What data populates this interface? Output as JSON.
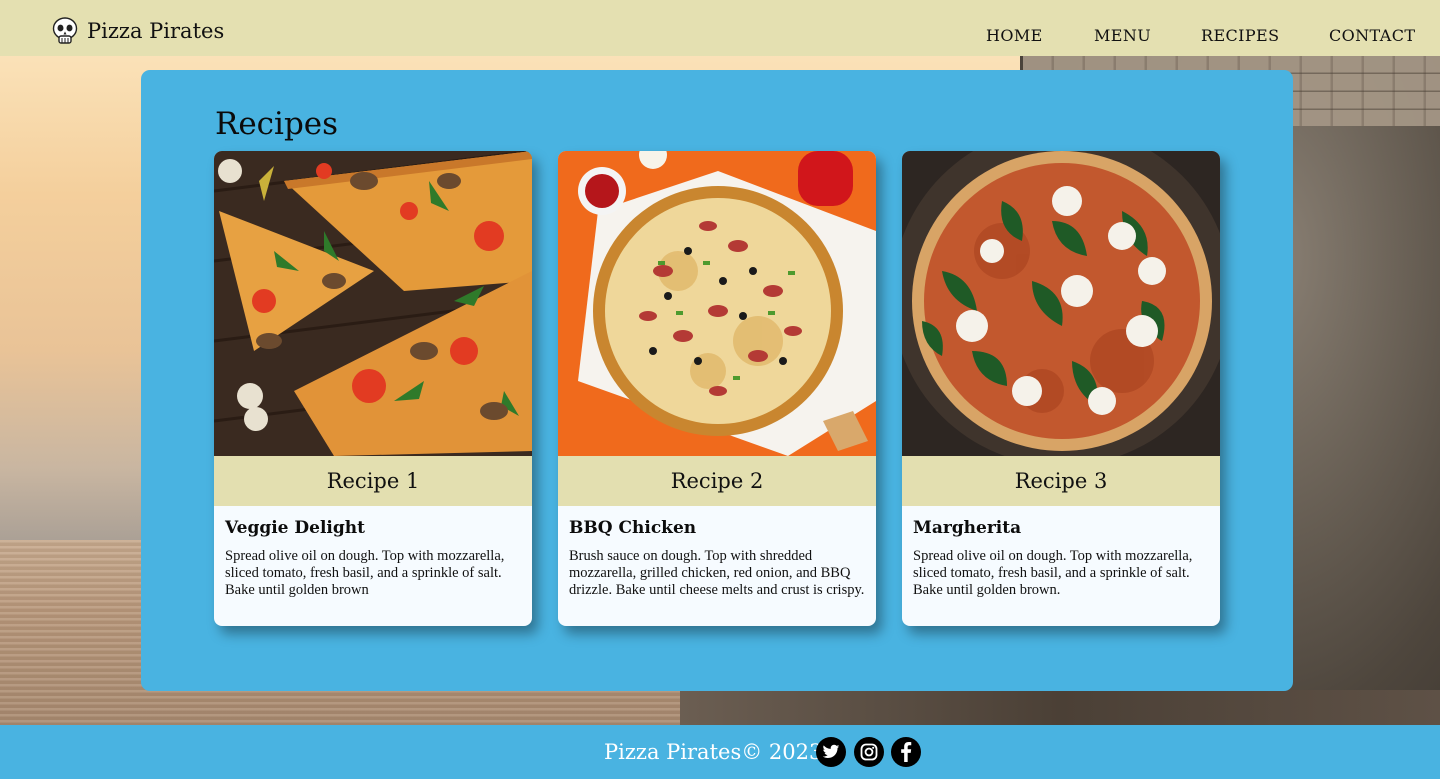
{
  "header": {
    "brand_name": "Pizza Pirates",
    "nav": [
      {
        "label": "HOME"
      },
      {
        "label": "MENU"
      },
      {
        "label": "RECIPES"
      },
      {
        "label": "CONTACT"
      }
    ]
  },
  "main": {
    "title": "Recipes",
    "cards": [
      {
        "heading": "Recipe 1",
        "name": "Veggie Delight",
        "description": "Spread olive oil on dough. Top with mozzarella, sliced tomato, fresh basil, and a sprinkle of salt. Bake until golden brown",
        "image_icon": "veggie-pizza-photo"
      },
      {
        "heading": "Recipe 2",
        "name": "BBQ Chicken",
        "description": "Brush sauce on dough. Top with shredded mozzarella, grilled chicken, red onion, and BBQ drizzle. Bake until cheese melts and crust is crispy.",
        "image_icon": "bbq-chicken-pizza-photo"
      },
      {
        "heading": "Recipe 3",
        "name": "Margherita",
        "description": "Spread olive oil on dough. Top with mozzarella, sliced tomato, fresh basil, and a sprinkle of salt. Bake until golden brown.",
        "image_icon": "margherita-pizza-photo"
      }
    ]
  },
  "footer": {
    "text": "Pizza Pirates© 2023",
    "social": [
      {
        "icon": "twitter-icon"
      },
      {
        "icon": "instagram-icon"
      },
      {
        "icon": "facebook-icon"
      }
    ]
  },
  "colors": {
    "header_bg": "#e4e0b1",
    "panel_bg": "#49b3e1",
    "card_band": "#e3dfb0",
    "card_body": "#f6fbff",
    "footer_bg": "#49b3e1"
  }
}
